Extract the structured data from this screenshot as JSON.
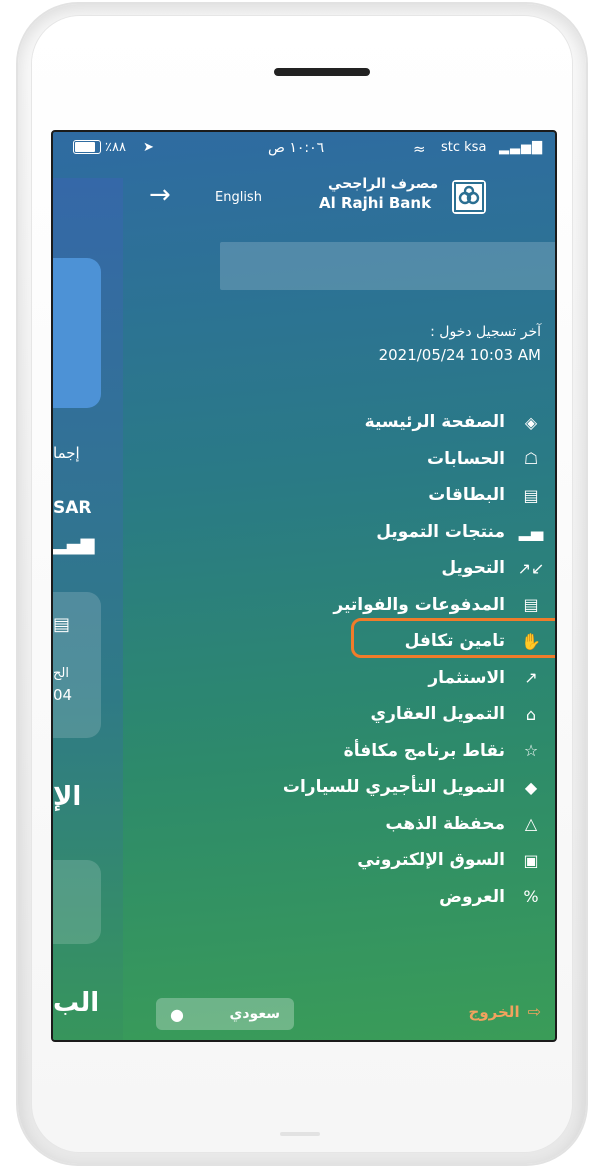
{
  "status_bar": {
    "battery": "٪٨٨",
    "time": "١٠:٠٦ ص",
    "carrier": "stc ksa"
  },
  "header": {
    "language_button": "English",
    "logo_arabic": "مصرف الراجحي",
    "logo_english": "Al Rajhi Bank"
  },
  "last_login": {
    "label": "آخر تسجيل دخول :",
    "value": "2021/05/24 10:03 AM"
  },
  "menu": [
    {
      "label": "الصفحة الرئيسية",
      "icon": "layers-icon"
    },
    {
      "label": "الحسابات",
      "icon": "bank-icon"
    },
    {
      "label": "البطاقات",
      "icon": "card-icon"
    },
    {
      "label": "منتجات التمويل",
      "icon": "bar-chart-icon"
    },
    {
      "label": "التحويل",
      "icon": "transfer-arrows-icon"
    },
    {
      "label": "المدفوعات والفواتير",
      "icon": "bill-icon",
      "highlighted": true
    },
    {
      "label": "تامين تكافل",
      "icon": "handshake-icon"
    },
    {
      "label": "الاستثمار",
      "icon": "trend-icon"
    },
    {
      "label": "التمويل العقاري",
      "icon": "house-icon"
    },
    {
      "label": "نقاط برنامج مكافأة",
      "icon": "trophy-icon"
    },
    {
      "label": "التمويل التأجيري للسيارات",
      "icon": "car-icon"
    },
    {
      "label": "محفظة الذهب",
      "icon": "gold-bars-icon"
    },
    {
      "label": "السوق الإلكتروني",
      "icon": "shopping-bag-icon"
    },
    {
      "label": "العروض",
      "icon": "percent-badge-icon"
    }
  ],
  "footer": {
    "region_button": "سعودي",
    "logout": "الخروج"
  },
  "peek": {
    "total_label": "إجما",
    "currency": "SAR",
    "card_label": "الح",
    "card_value": "04",
    "big_label_1": "الإ",
    "big_label_2": "الب"
  },
  "colors": {
    "highlight": "#f07c2a",
    "logout": "#f2a25e"
  }
}
